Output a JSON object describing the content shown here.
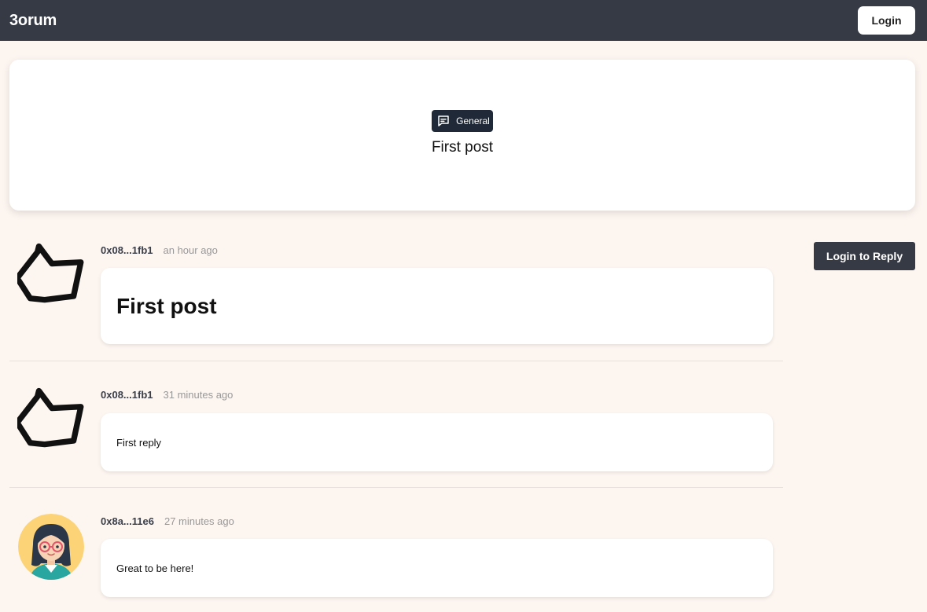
{
  "header": {
    "brand": "3orum",
    "login_label": "Login"
  },
  "topic": {
    "category": "General",
    "category_icon": "chat-bubble-icon",
    "title": "First post"
  },
  "actions": {
    "reply_label": "Login to Reply"
  },
  "posts": [
    {
      "author": "0x08...1fb1",
      "time": "an hour ago",
      "heading": "First post",
      "avatar": "crown-outline-icon"
    },
    {
      "author": "0x08...1fb1",
      "time": "31 minutes ago",
      "text": "First reply",
      "avatar": "crown-outline-icon"
    },
    {
      "author": "0x8a...11e6",
      "time": "27 minutes ago",
      "text": "Great to be here!",
      "avatar": "girl-with-glasses-avatar"
    }
  ],
  "colors": {
    "navbar": "#363a45",
    "page_background": "#fdf5f0",
    "badge": "#1f2937",
    "avatar_background": "#fcd377"
  }
}
